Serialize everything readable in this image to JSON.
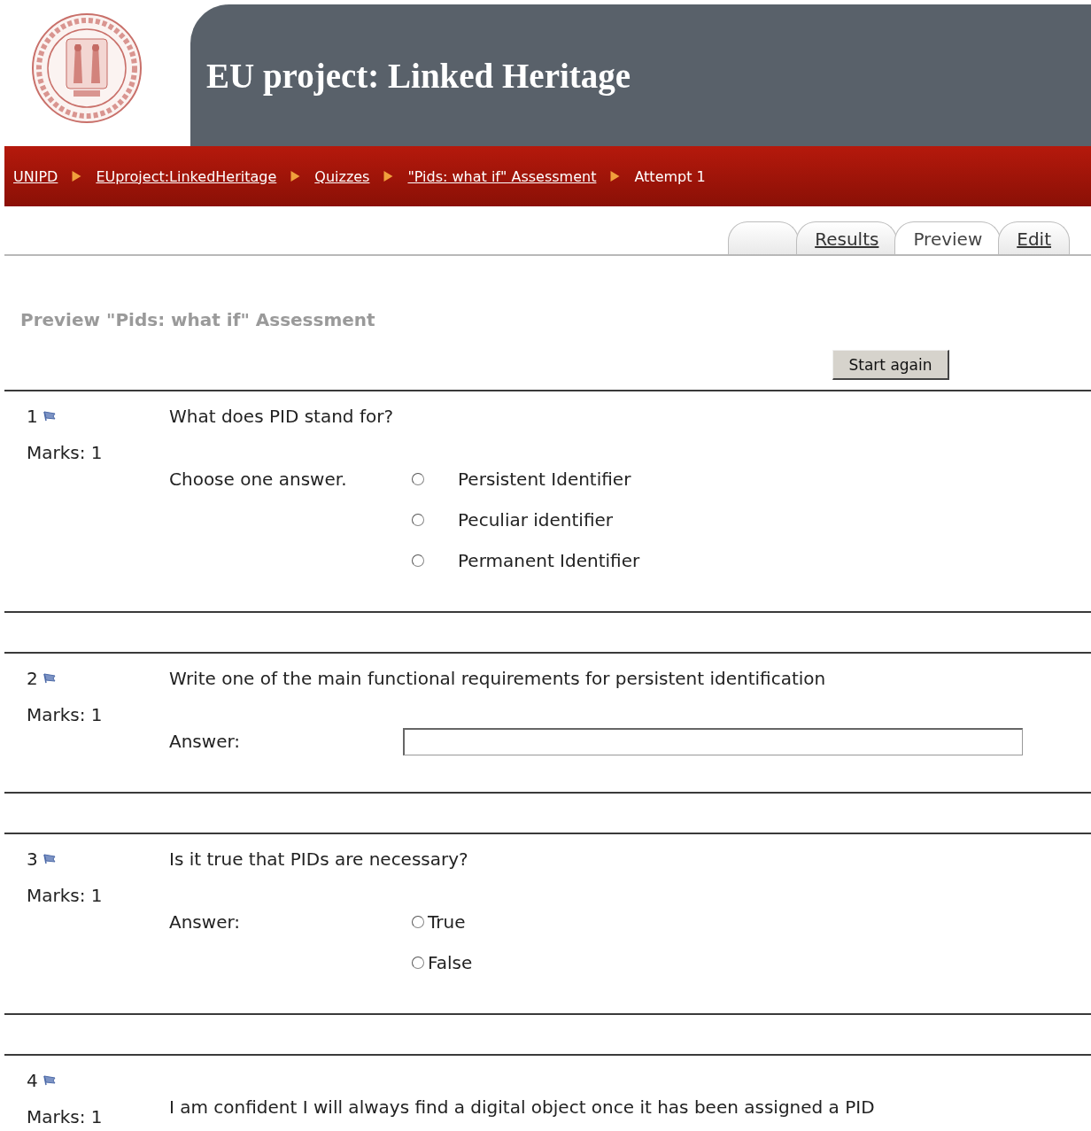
{
  "header": {
    "title": "EU project: Linked Heritage"
  },
  "breadcrumb": [
    {
      "label": "UNIPD",
      "link": true
    },
    {
      "label": "EUproject:LinkedHeritage",
      "link": true
    },
    {
      "label": "Quizzes",
      "link": true
    },
    {
      "label": "\"Pids: what if\" Assessment",
      "link": true
    },
    {
      "label": "Attempt 1",
      "link": false
    }
  ],
  "tabs": [
    {
      "selected": false
    },
    {
      "label": "Results",
      "selected": false
    },
    {
      "label": "Preview",
      "selected": true
    },
    {
      "label": "Edit",
      "selected": false
    }
  ],
  "heading": "Preview \"Pids: what if\" Assessment",
  "start_button": "Start again",
  "questions": [
    {
      "kind": "multichoice",
      "number": "1",
      "marks": "Marks: 1",
      "text": "What does PID stand for?",
      "answer_label": "Choose one answer.",
      "options": [
        {
          "label": "Persistent Identifier",
          "selected": false
        },
        {
          "label": "Peculiar identifier",
          "selected": false
        },
        {
          "label": "Permanent Identifier",
          "selected": false
        }
      ]
    },
    {
      "kind": "shortanswer",
      "number": "2",
      "marks": "Marks: 1",
      "text": "Write one of the main functional requirements for persistent identification",
      "answer_label": "Answer:"
    },
    {
      "kind": "truefalse",
      "number": "3",
      "marks": "Marks: 1",
      "text": "Is it true that PIDs are necessary?",
      "answer_label": "Answer:",
      "options": [
        {
          "label": "True",
          "selected": false
        },
        {
          "label": "False",
          "selected": false
        }
      ]
    },
    {
      "kind": "statement",
      "number": "4",
      "marks": "Marks: 1",
      "text": "I am confident I will always find a digital object once it has been assigned a PID"
    }
  ]
}
